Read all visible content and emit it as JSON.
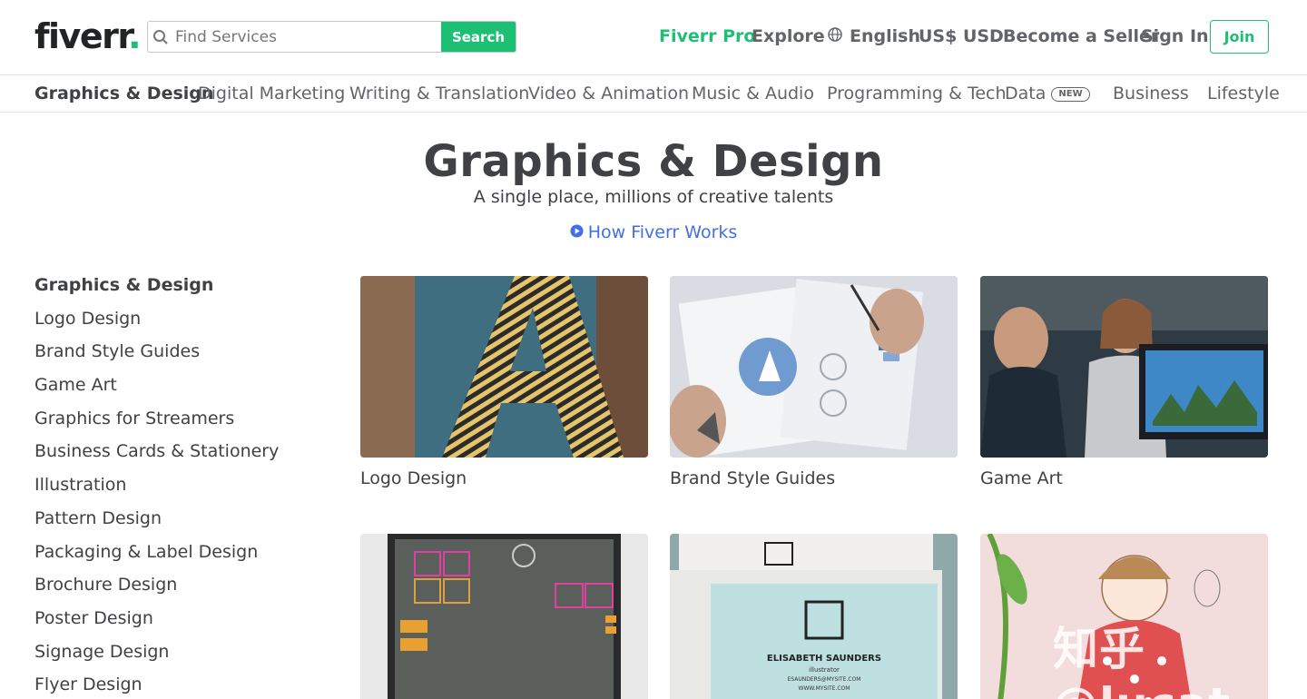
{
  "brand": {
    "logo_text": "fiverr",
    "logo_dot": ".",
    "accent": "#1dbf73"
  },
  "search": {
    "placeholder": "Find Services",
    "button_label": "Search"
  },
  "top_nav": {
    "pro": "Fiverr Pro",
    "explore": "Explore",
    "language": "English",
    "currency": "US$ USD",
    "become_seller": "Become a Seller",
    "sign_in": "Sign In",
    "join": "Join"
  },
  "categories": [
    {
      "label": "Graphics & Design"
    },
    {
      "label": "Digital Marketing"
    },
    {
      "label": "Writing & Translation"
    },
    {
      "label": "Video & Animation"
    },
    {
      "label": "Music & Audio"
    },
    {
      "label": "Programming & Tech"
    },
    {
      "label": "Data",
      "badge": "NEW"
    },
    {
      "label": "Business"
    },
    {
      "label": "Lifestyle"
    }
  ],
  "hero": {
    "title": "Graphics & Design",
    "subtitle": "A single place, millions of creative talents",
    "how_link": "How Fiverr Works"
  },
  "sidebar": {
    "heading": "Graphics & Design",
    "items": [
      "Logo Design",
      "Brand Style Guides",
      "Game Art",
      "Graphics for Streamers",
      "Business Cards & Stationery",
      "Illustration",
      "Pattern Design",
      "Packaging & Label Design",
      "Brochure Design",
      "Poster Design",
      "Signage Design",
      "Flyer Design"
    ]
  },
  "cards": [
    {
      "label": "Logo Design"
    },
    {
      "label": "Brand Style Guides"
    },
    {
      "label": "Game Art"
    }
  ],
  "business_card": {
    "name": "ELISABETH SAUNDERS",
    "role": "illustrator",
    "email": "ESAUNDERS@MYSITE.COM",
    "site": "WWW.MYSITE.COM"
  },
  "watermark": "知乎 @lucat"
}
